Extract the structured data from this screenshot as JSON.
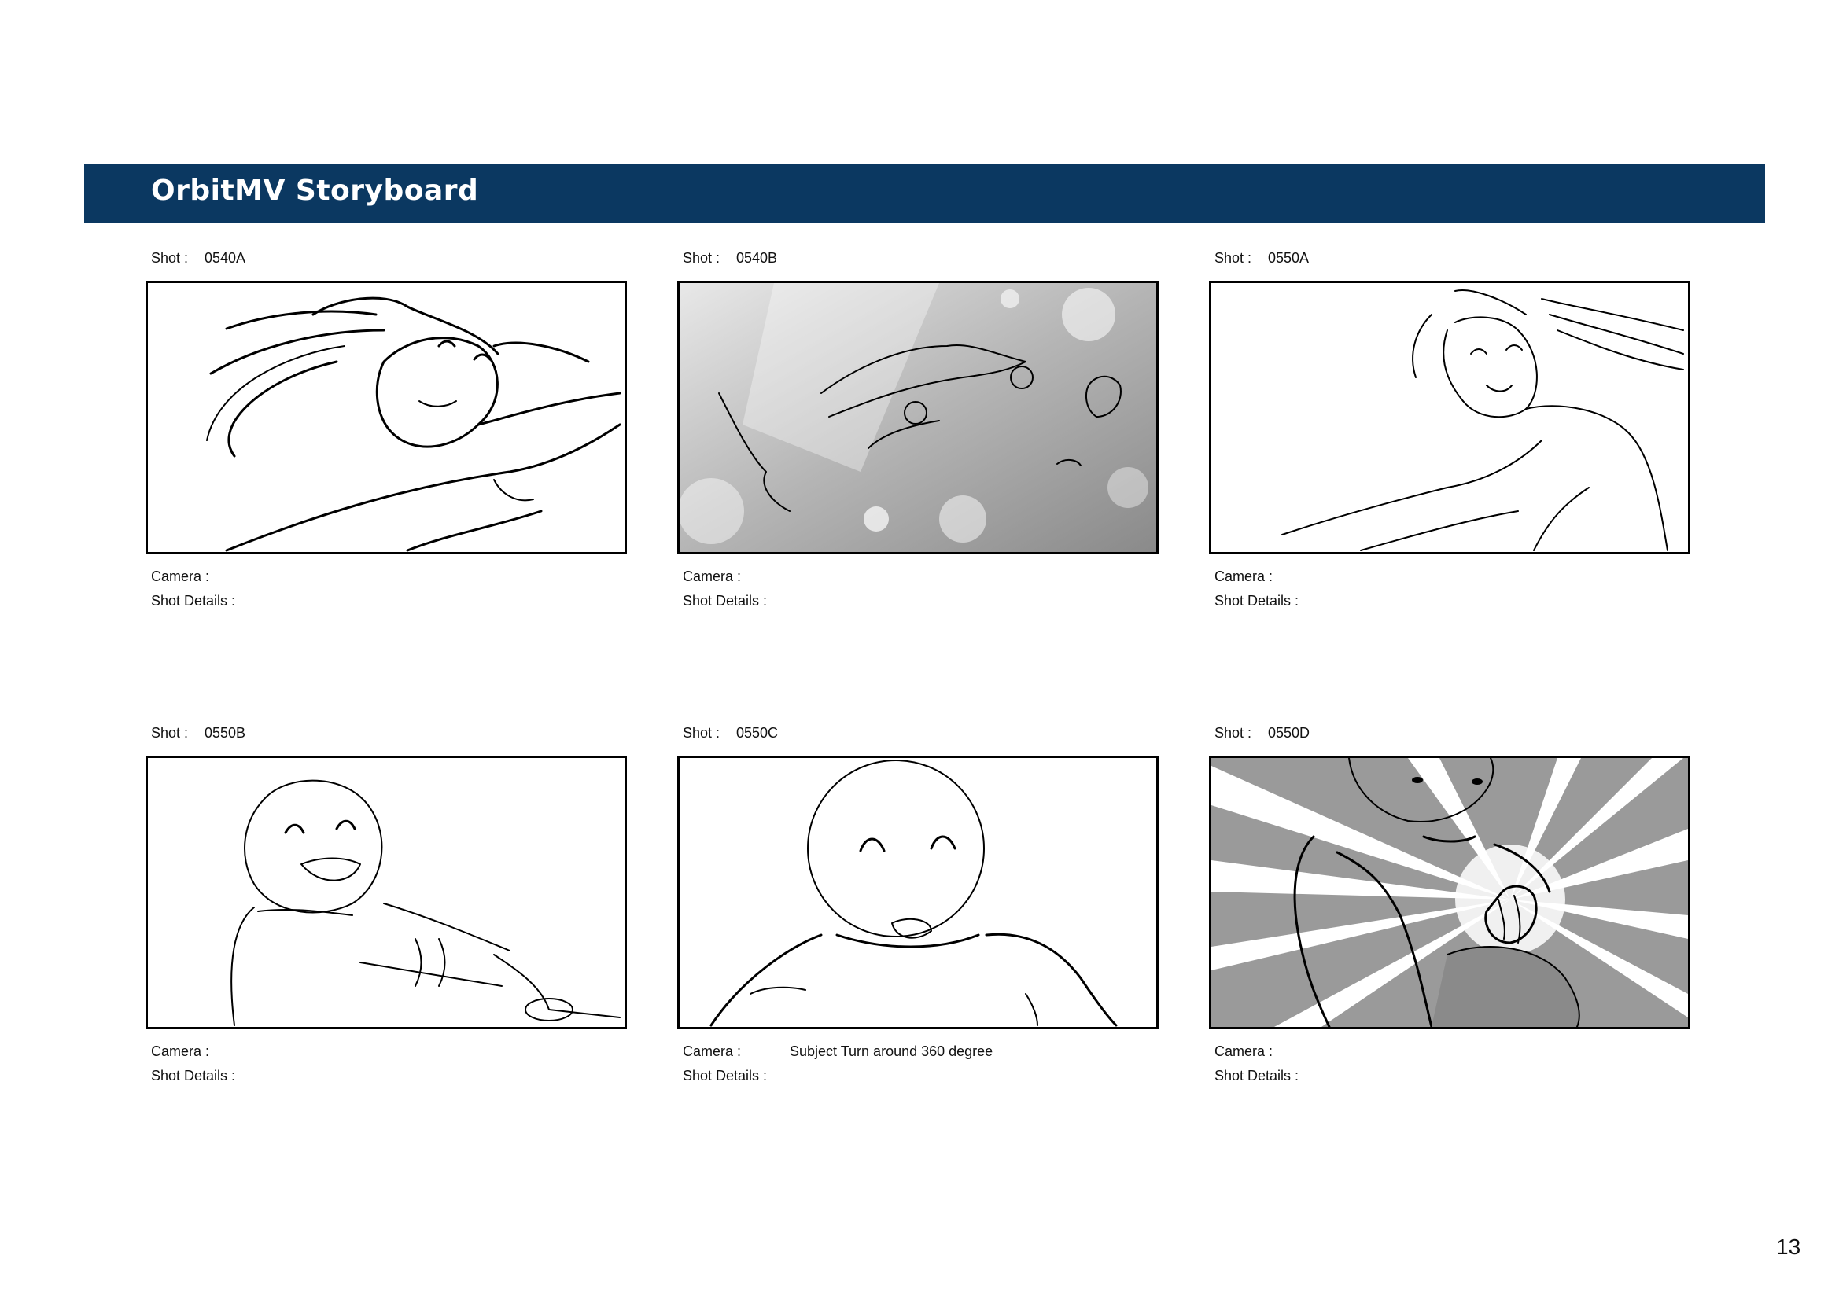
{
  "header": {
    "title": "OrbitMV Storyboard",
    "bar_color": "#0b3861"
  },
  "labels": {
    "shot": "Shot :",
    "camera": "Camera :",
    "details": "Shot Details :"
  },
  "panels": [
    {
      "shot": "0540A",
      "camera": "",
      "details": "",
      "frame_icon": "sketch-girl-flying-hair-icon"
    },
    {
      "shot": "0540B",
      "camera": "",
      "details": "",
      "frame_icon": "sketch-flying-group-bubbles-icon"
    },
    {
      "shot": "0550A",
      "camera": "",
      "details": "",
      "frame_icon": "sketch-girl-smiling-wind-icon"
    },
    {
      "shot": "0550B",
      "camera": "",
      "details": "",
      "frame_icon": "sketch-laughing-child-reaching-icon"
    },
    {
      "shot": "0550C",
      "camera": "Subject Turn around 360 degree",
      "details": "",
      "frame_icon": "sketch-surprised-child-icon"
    },
    {
      "shot": "0550D",
      "camera": "",
      "details": "",
      "frame_icon": "sketch-child-holding-light-icon"
    }
  ],
  "page_number": "13"
}
